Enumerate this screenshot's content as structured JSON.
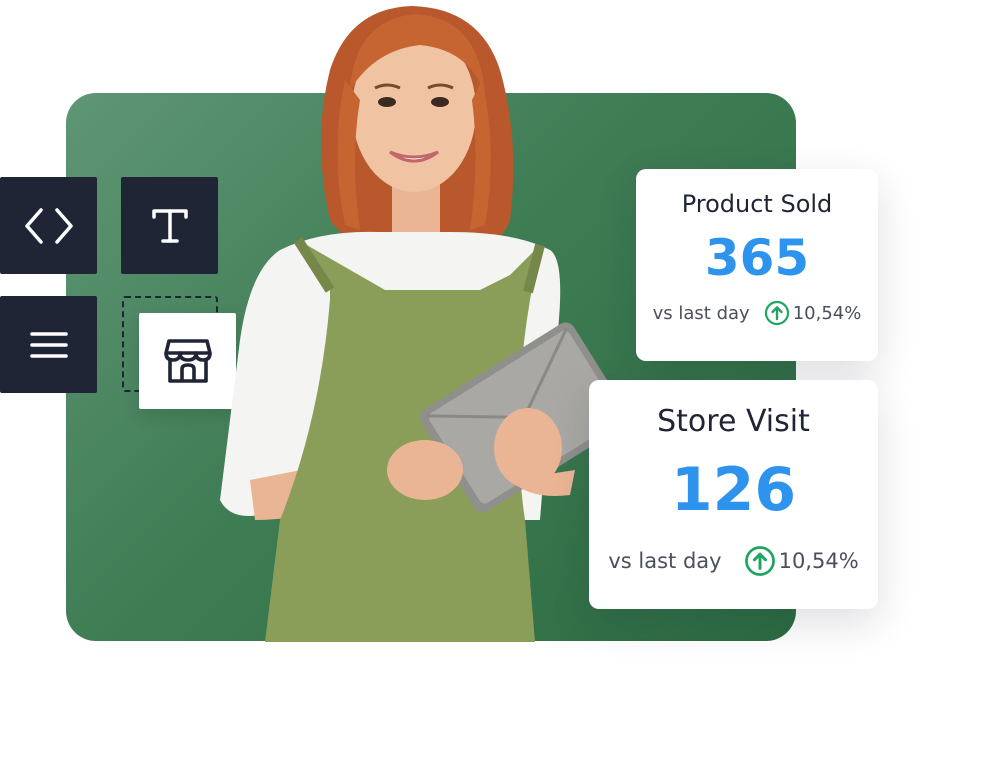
{
  "tools": [
    {
      "name": "code",
      "icon": "code-brackets-icon"
    },
    {
      "name": "text",
      "icon": "text-t-icon"
    },
    {
      "name": "menu",
      "icon": "hamburger-menu-icon"
    },
    {
      "name": "store",
      "icon": "storefront-icon"
    }
  ],
  "product_card": {
    "title": "Product Sold",
    "value": "365",
    "compare_label": "vs last day",
    "delta": "10,54%",
    "delta_icon": "arrow-up-circle-icon"
  },
  "store_card": {
    "title": "Store Visit",
    "value": "126",
    "compare_label": "vs last day",
    "delta": "10,54%",
    "delta_icon": "arrow-up-circle-icon"
  },
  "colors": {
    "panel_green": "#3f7d55",
    "tile_dark": "#1f2535",
    "value_blue": "#2d93ec",
    "delta_green": "#1fa463"
  }
}
